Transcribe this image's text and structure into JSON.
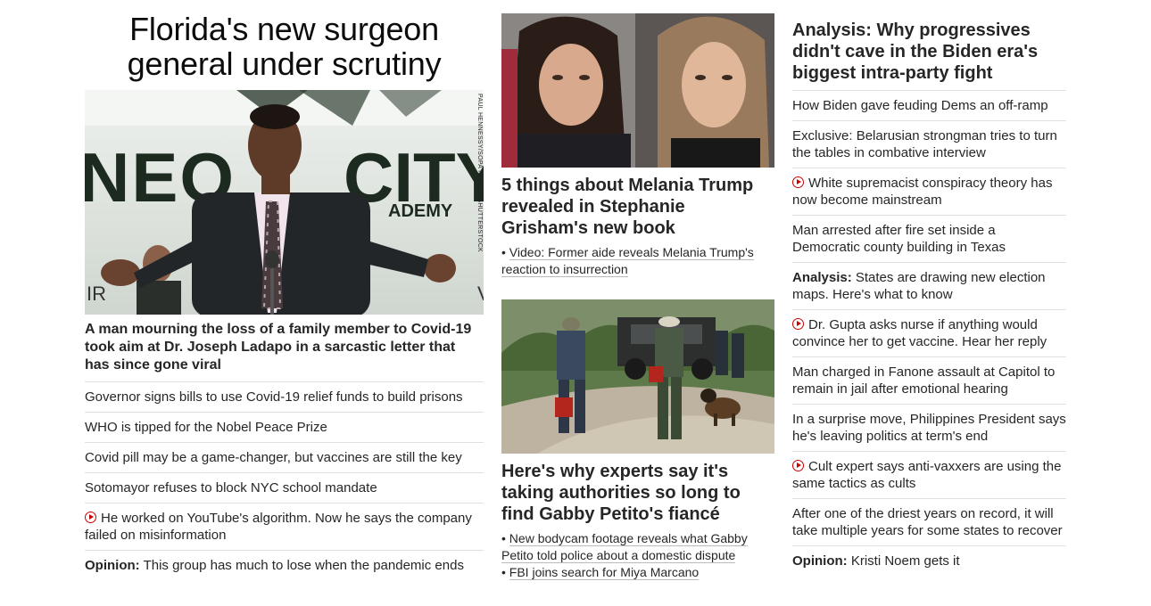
{
  "left": {
    "title": "Florida's new surgeon general under scrutiny",
    "image_credit": "PAUL HENNESSY/SOPA IMAGES/SHUTTERSTOCK",
    "image_sign_text": "NEO CITY ACADEMY",
    "subhead": "A man mourning the loss of a family member to Covid-19 took aim at Dr. Joseph Ladapo in a sarcastic letter that has since gone viral",
    "items": [
      {
        "text": "Governor signs bills to use Covid-19 relief funds to build prisons"
      },
      {
        "text": "WHO is tipped for the Nobel Peace Prize"
      },
      {
        "text": "Covid pill may be a game-changer, but vaccines are still the key"
      },
      {
        "text": "Sotomayor refuses to block NYC school mandate"
      },
      {
        "text": "He worked on YouTube's algorithm. Now he says the company failed on misinformation",
        "video": true
      },
      {
        "prefix": "Opinion:",
        "text": "This group has much to lose when the pandemic ends"
      }
    ]
  },
  "middle": {
    "card1": {
      "title": "5 things about Melania Trump revealed in Stephanie Grisham's new book",
      "links": [
        "Video: Former aide reveals Melania Trump's reaction to insurrection"
      ]
    },
    "card2": {
      "title": "Here's why experts say it's taking authorities so long to find Gabby Petito's fiancé",
      "links": [
        "New bodycam footage reveals what Gabby Petito told police about a domestic dispute",
        "FBI joins search for Miya Marcano"
      ]
    }
  },
  "right": {
    "title": "Analysis: Why progressives didn't cave in the Biden era's biggest intra-party fight",
    "items": [
      {
        "text": "How Biden gave feuding Dems an off-ramp"
      },
      {
        "text": "Exclusive: Belarusian strongman tries to turn the tables in combative interview"
      },
      {
        "text": "White supremacist conspiracy theory has now become mainstream",
        "video": true
      },
      {
        "text": "Man arrested after fire set inside a Democratic county building in Texas"
      },
      {
        "prefix": "Analysis:",
        "text": "States are drawing new election maps. Here's what to know"
      },
      {
        "text": "Dr. Gupta asks nurse if anything would convince her to get vaccine. Hear her reply",
        "video": true
      },
      {
        "text": "Man charged in Fanone assault at Capitol to remain in jail after emotional hearing"
      },
      {
        "text": "In a surprise move, Philippines President says he's leaving politics at term's end"
      },
      {
        "text": "Cult expert says anti-vaxxers are using the same tactics as cults",
        "video": true
      },
      {
        "text": "After one of the driest years on record, it will take multiple years for some states to recover"
      },
      {
        "prefix": "Opinion:",
        "text": "Kristi Noem gets it"
      }
    ]
  },
  "colors": {
    "video_icon": "#cc0000",
    "divider": "#e0e0e0",
    "text": "#262626"
  }
}
